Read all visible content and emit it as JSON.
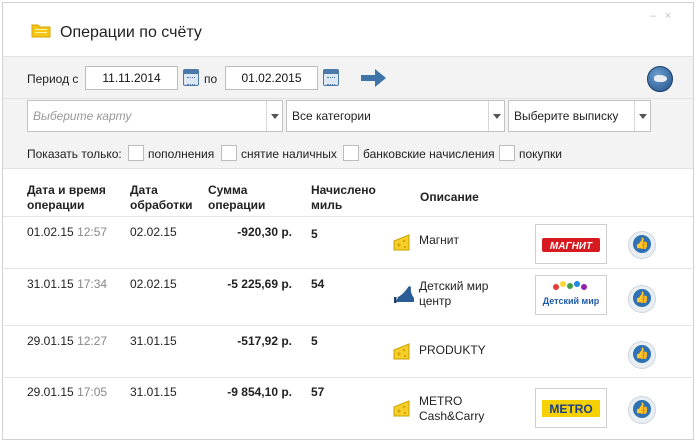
{
  "window": {
    "title": "Операции по счёту",
    "minimize_glyph": "–",
    "close_glyph": "×"
  },
  "period": {
    "label": "Период с",
    "from": "11.11.2014",
    "to_label": "по",
    "to": "01.02.2015"
  },
  "selects": {
    "card": "Выберите карту",
    "category": "Все категории",
    "statement": "Выберите выписку"
  },
  "show_only": {
    "label": "Показать только:",
    "options": [
      "пополнения",
      "снятие наличных",
      "банковские начисления",
      "покупки"
    ]
  },
  "table": {
    "headers": {
      "datetime": [
        "Дата и время",
        "операции"
      ],
      "processed": [
        "Дата",
        "обработки"
      ],
      "amount": [
        "Сумма",
        "операции"
      ],
      "miles": [
        "Начислено",
        "миль"
      ],
      "description": "Описание"
    },
    "rows": [
      {
        "date": "01.02.15",
        "time": "12:57",
        "processed": "02.02.15",
        "amount": "-920,30 р.",
        "miles": "5",
        "description": [
          "Магнит"
        ],
        "icon": "cheese-icon",
        "logo": "МАГНИТ"
      },
      {
        "date": "31.01.15",
        "time": "17:34",
        "processed": "02.02.15",
        "amount": "-5 225,69 р.",
        "miles": "54",
        "description": [
          "Детский мир",
          "центр"
        ],
        "icon": "shoe-icon",
        "logo": "Детский мир"
      },
      {
        "date": "29.01.15",
        "time": "12:27",
        "processed": "31.01.15",
        "amount": "-517,92 р.",
        "miles": "5",
        "description": [
          "PRODUKTY"
        ],
        "icon": "cheese-icon",
        "logo": ""
      },
      {
        "date": "29.01.15",
        "time": "17:05",
        "processed": "31.01.15",
        "amount": "-9 854,10 р.",
        "miles": "57",
        "description": [
          "METRO",
          "Cash&Carry"
        ],
        "icon": "cheese-icon",
        "logo": "METRO"
      }
    ]
  },
  "colors": {
    "accent": "#2f72b4",
    "magnit_red": "#d71920",
    "metro_yellow": "#f6d000",
    "metro_blue": "#1a3e8f"
  }
}
